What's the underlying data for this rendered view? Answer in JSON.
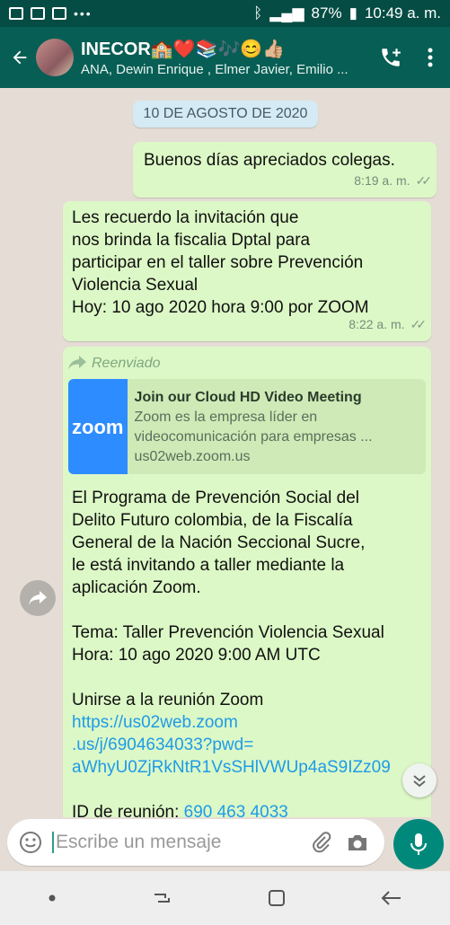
{
  "status_bar": {
    "battery": "87%",
    "time": "10:49 a. m."
  },
  "header": {
    "title": "INECOR🏫❤️📚🎶😊👍🏼",
    "subtitle": "ANA, Dewin Enrique , Elmer Javier, Emilio ..."
  },
  "date_label": "10 DE AGOSTO DE 2020",
  "messages": [
    {
      "text": "Buenos días apreciados colegas.",
      "time": "8:19 a. m."
    },
    {
      "text": "Les recuerdo la invitación  que\nnos brinda la fiscalia  Dptal para\nparticipar en el taller sobre  Prevención\nViolencia Sexual\nHoy: 10 ago 2020  hora 9:00 por ZOOM",
      "time": "8:22 a. m."
    }
  ],
  "forwarded": {
    "label": "Reenviado",
    "preview": {
      "logo": "zoom",
      "title": "Join our Cloud HD Video Meeting",
      "description": "Zoom es la empresa líder en videocomunicación para empresas ...",
      "domain": "us02web.zoom.us"
    },
    "body": "El Programa de Prevención Social del\nDelito Futuro colombia, de la Fiscalía\nGeneral de la Nación Seccional Sucre,\nle está invitando a taller mediante la\naplicación Zoom.",
    "topic": "Tema: Taller Prevención Violencia Sexual\nHora: 10 ago 2020 9:00 AM UTC",
    "join_label": "Unirse a la reunión Zoom",
    "join_link": "https://us02web.zoom\n.us/j/6904634033?pwd=\naWhyU0ZjRkNtR1VsSHlVWUp4aS9IZz09",
    "meeting_id_label": "ID de reunión:",
    "meeting_id": "690 463 4033"
  },
  "input": {
    "placeholder": "Escribe un mensaje"
  },
  "colors": {
    "header": "#075e54",
    "bubble": "#dcf8c6",
    "accent": "#00897b",
    "link": "#1e9be8"
  },
  "icons": [
    "back-arrow-icon",
    "add-call-icon",
    "more-vert-icon",
    "forward-icon",
    "chevron-down-icon",
    "emoji-icon",
    "attach-icon",
    "camera-icon",
    "mic-icon"
  ]
}
